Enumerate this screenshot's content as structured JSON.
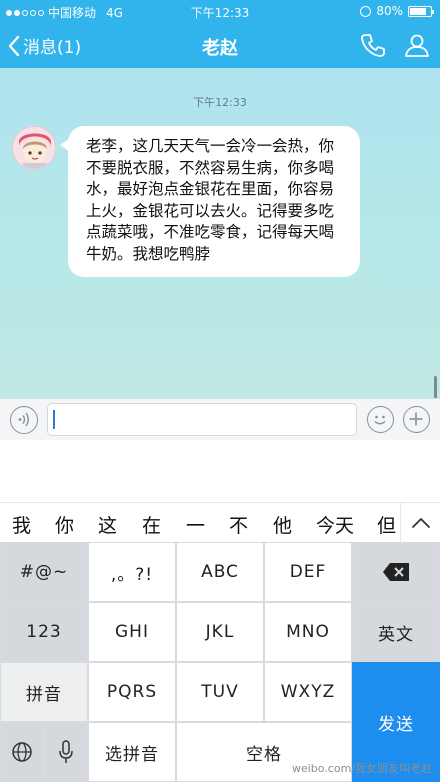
{
  "status_bar": {
    "carrier": "中国移动",
    "network": "4G",
    "time": "下午12:33",
    "battery": "80%",
    "battery_level": 0.8
  },
  "nav": {
    "back_label": "消息(1)",
    "title": "老赵",
    "icons": [
      "chevron-left-icon",
      "phone-icon",
      "profile-icon"
    ]
  },
  "chat": {
    "timestamp": "下午12:33",
    "messages": [
      {
        "sender_avatar": "avatar-girl-icon",
        "text": "老李，这几天天气一会冷一会热，你不要脱衣服，不然容易生病，你多喝水，最好泡点金银花在里面，你容易上火，金银花可以去火。记得要多吃点蔬菜哦，不准吃零食，记得每天喝牛奶。我想吃鸭脖"
      }
    ]
  },
  "input_bar": {
    "value": "",
    "icons": [
      "voice-icon",
      "emoji-icon",
      "plus-icon"
    ]
  },
  "candidates": [
    "我",
    "你",
    "这",
    "在",
    "一",
    "不",
    "他",
    "今天",
    "但"
  ],
  "keyboard": {
    "row1": [
      "#@~",
      ",。?!",
      "ABC",
      "DEF"
    ],
    "row2": [
      "123",
      "GHI",
      "JKL",
      "MNO",
      "英文"
    ],
    "row3": [
      "拼音",
      "PQRS",
      "TUV",
      "WXYZ"
    ],
    "row4": [
      "选拼音",
      "空格"
    ],
    "send": "发送",
    "icons": [
      "backspace-icon",
      "globe-icon",
      "microphone-icon",
      "chevron-up-icon"
    ]
  },
  "watermark": "weibo.com/我女朋友叫老赵",
  "colors": {
    "header": "#31b3ec",
    "send_key": "#1e8df0",
    "bubble": "#ffffff"
  }
}
